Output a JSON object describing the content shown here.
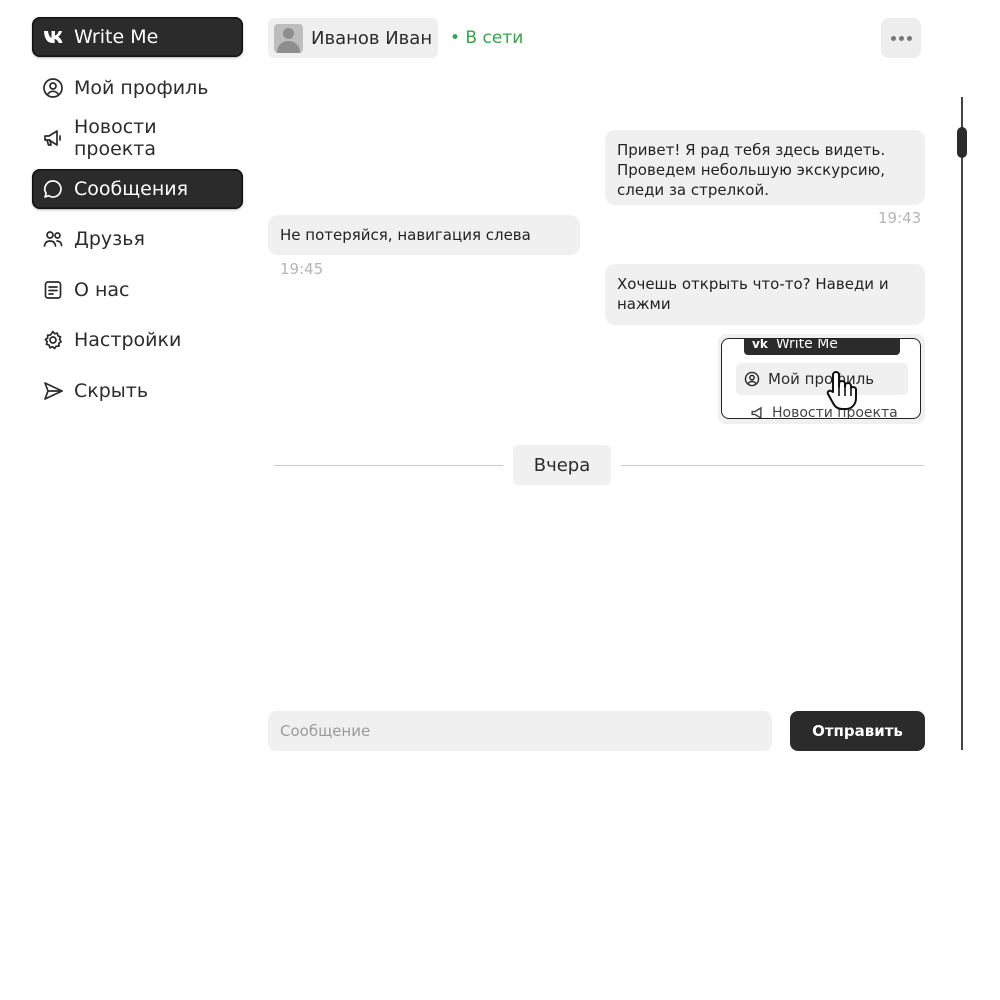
{
  "sidebar": {
    "items": [
      {
        "label": "Write Me",
        "icon": "vk-logo-icon",
        "active": true
      },
      {
        "label": "Мой профиль",
        "icon": "user-circle-icon",
        "active": false
      },
      {
        "label": "Новости проекта",
        "icon": "megaphone-icon",
        "active": false
      },
      {
        "label": "Сообщения",
        "icon": "chat-bubble-icon",
        "active": true
      },
      {
        "label": "Друзья",
        "icon": "users-icon",
        "active": false
      },
      {
        "label": "О нас",
        "icon": "info-card-icon",
        "active": false
      },
      {
        "label": "Настройки",
        "icon": "gear-icon",
        "active": false
      },
      {
        "label": "Скрыть",
        "icon": "send-arrow-icon",
        "active": false
      }
    ]
  },
  "header": {
    "user_name": "Иванов Иван",
    "status": "• В сети",
    "status_color": "#2ca84a",
    "more_icon": "more-dots-icon"
  },
  "messages": [
    {
      "side": "right",
      "text": "Привет! Я рад тебя здесь видеть. Проведем небольшую экскурсию, следи за стрелкой.",
      "time": "19:43"
    },
    {
      "side": "left",
      "text": "Не потеряйся, навигация слева",
      "time": "19:45"
    },
    {
      "side": "right",
      "text": "Хочешь открыть что-то? Наведи и нажми",
      "time": ""
    }
  ],
  "preview": {
    "items": [
      "Write Me",
      "Мой профиль",
      "Новости проекта"
    ]
  },
  "divider": {
    "label": "Вчера"
  },
  "composer": {
    "placeholder": "Сообщение",
    "send_label": "Отправить"
  },
  "colors": {
    "accent": "#2b2b2b",
    "bubble": "#f0f0f0"
  }
}
